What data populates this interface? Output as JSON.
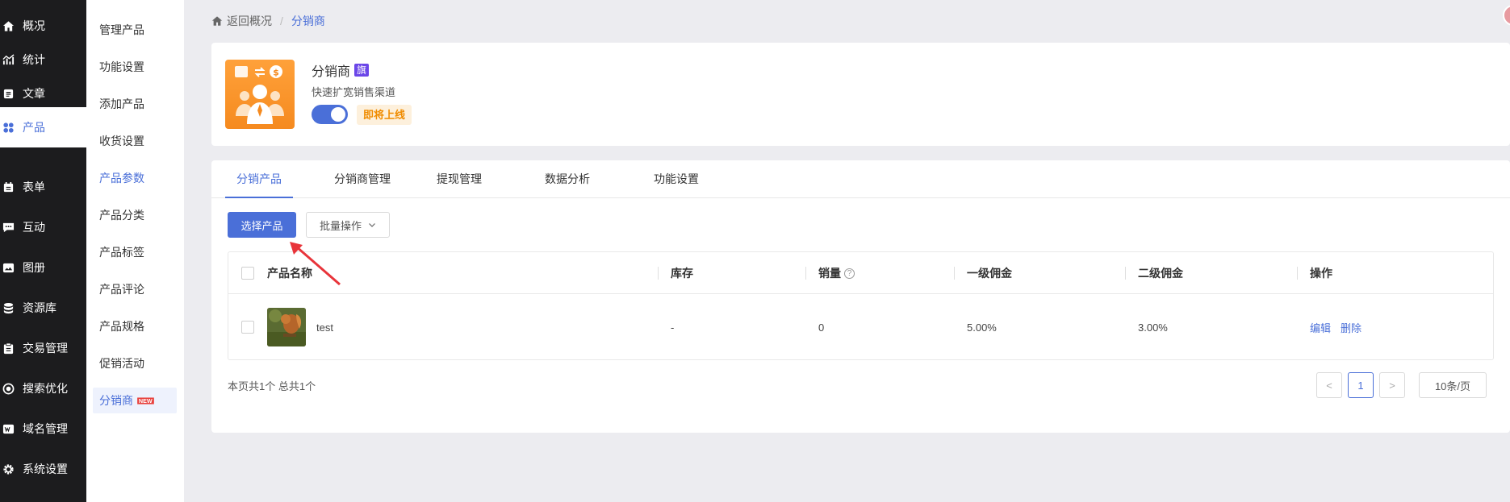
{
  "sidebar": {
    "items": [
      {
        "label": "概况",
        "icon": "home-icon"
      },
      {
        "label": "统计",
        "icon": "chart-icon"
      },
      {
        "label": "文章",
        "icon": "article-icon"
      },
      {
        "label": "产品",
        "icon": "grid-icon"
      },
      {
        "label": "表单",
        "icon": "form-icon"
      },
      {
        "label": "互动",
        "icon": "chat-icon"
      },
      {
        "label": "图册",
        "icon": "image-icon"
      },
      {
        "label": "资源库",
        "icon": "database-icon"
      },
      {
        "label": "交易管理",
        "icon": "clipboard-icon"
      },
      {
        "label": "搜索优化",
        "icon": "target-icon"
      },
      {
        "label": "域名管理",
        "icon": "domain-icon"
      },
      {
        "label": "系统设置",
        "icon": "gear-icon"
      }
    ],
    "active": "产品"
  },
  "subnav": {
    "items": [
      {
        "label": "管理产品"
      },
      {
        "label": "功能设置"
      },
      {
        "label": "添加产品"
      },
      {
        "label": "收货设置"
      },
      {
        "label": "产品参数"
      },
      {
        "label": "产品分类"
      },
      {
        "label": "产品标签"
      },
      {
        "label": "产品评论"
      },
      {
        "label": "产品规格"
      },
      {
        "label": "促销活动"
      },
      {
        "label": "分销商",
        "badge": "NEW"
      }
    ]
  },
  "breadcrumb": {
    "back": "返回概况",
    "sep": "/",
    "current": "分销商"
  },
  "app": {
    "title": "分销商",
    "flag": "旗",
    "desc": "快速扩宽销售渠道",
    "toggle_on": true,
    "status": "即将上线"
  },
  "tabs": [
    "分销产品",
    "分销商管理",
    "提现管理",
    "数据分析",
    "功能设置"
  ],
  "toolbar": {
    "select_label": "选择产品",
    "batch_label": "批量操作"
  },
  "table": {
    "headers": [
      "产品名称",
      "库存",
      "销量",
      "一级佣金",
      "二级佣金",
      "操作"
    ],
    "help_glyph": "?",
    "rows": [
      {
        "name": "test",
        "stock": "-",
        "sales": "0",
        "level1": "5.00%",
        "level2": "3.00%",
        "edit": "编辑",
        "delete": "删除"
      }
    ]
  },
  "pagination": {
    "summary": "本页共1个 总共1个",
    "prev": "<",
    "page": "1",
    "next": ">",
    "page_size": "10条/页"
  },
  "colors": {
    "accent": "#4a6fd8",
    "sidebar_bg": "#1c1c1e",
    "logo_orange": "#f58a1f",
    "flag_purple": "#6b46e8",
    "arrow_red": "#e8343a"
  }
}
